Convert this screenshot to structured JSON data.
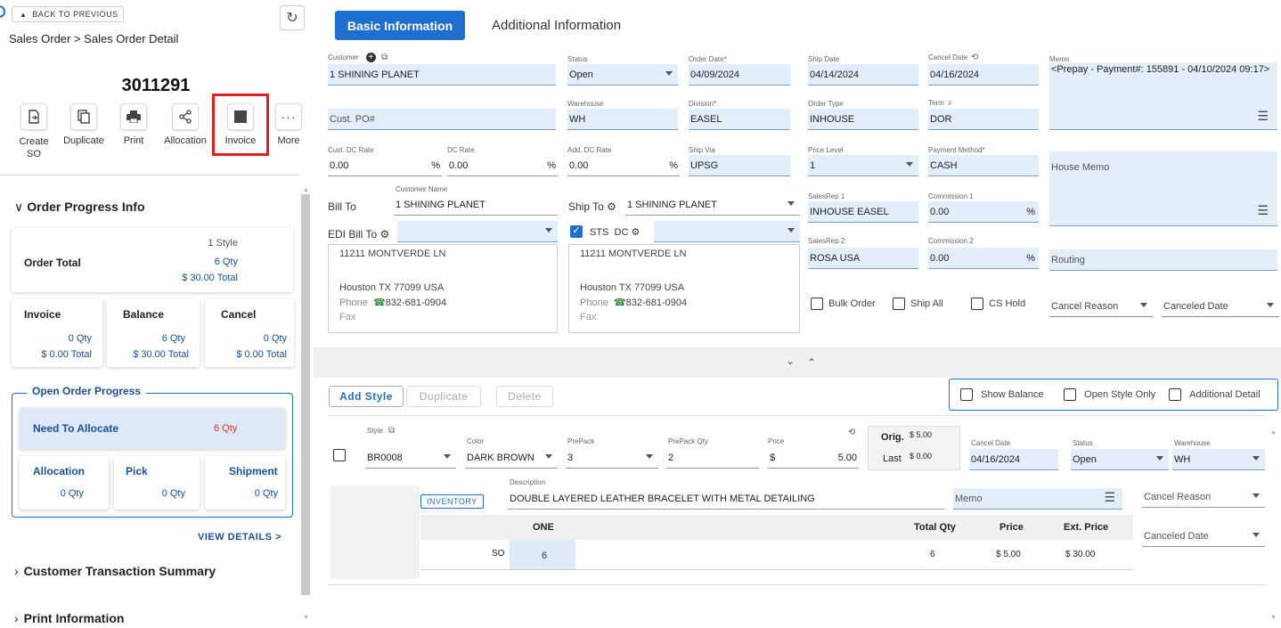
{
  "sidebar": {
    "back_label": "BACK TO PREVIOUS",
    "breadcrumb": "Sales Order > Sales Order Detail",
    "order_number": "3011291",
    "toolbar": [
      {
        "label": "Create SO",
        "icon": "create-icon"
      },
      {
        "label": "Duplicate",
        "icon": "duplicate-icon"
      },
      {
        "label": "Print",
        "icon": "print-icon"
      },
      {
        "label": "Allocation",
        "icon": "share-icon"
      },
      {
        "label": "Invoice",
        "icon": "invoice-icon"
      },
      {
        "label": "More",
        "icon": "more-icon"
      }
    ],
    "order_progress": {
      "title": "Order Progress Info",
      "order_total_label": "Order Total",
      "styles": "1 Style",
      "qty": "6 Qty",
      "total": "$ 30.00 Total",
      "invoice": {
        "label": "Invoice",
        "qty": "0 Qty",
        "total": "$ 0.00 Total"
      },
      "balance": {
        "label": "Balance",
        "qty": "6 Qty",
        "total": "$ 30.00 Total"
      },
      "cancel": {
        "label": "Cancel",
        "qty": "0 Qty",
        "total": "$ 0.00 Total"
      }
    },
    "open_order": {
      "title": "Open Order Progress",
      "need_label": "Need To Allocate",
      "need_qty": "6 Qty",
      "allocation": {
        "label": "Allocation",
        "qty": "0 Qty"
      },
      "pick": {
        "label": "Pick",
        "qty": "0 Qty"
      },
      "shipment": {
        "label": "Shipment",
        "qty": "0 Qty"
      }
    },
    "view_details": "VIEW DETAILS >",
    "customer_summary": "Customer Transaction Summary",
    "print_info": "Print Information"
  },
  "tabs": {
    "basic": "Basic Information",
    "additional": "Additional Information"
  },
  "form": {
    "customer_label": "Customer",
    "customer": "1 SHINING PLANET",
    "status_label": "Status",
    "status": "Open",
    "order_date_label": "Order Date",
    "order_date": "04/09/2024",
    "ship_date_label": "Ship Date",
    "ship_date": "04/14/2024",
    "cancel_date_label": "Cancel Date",
    "cancel_date": "04/16/2024",
    "memo_label": "Memo",
    "memo": "<Prepay - Payment#: 155891 - 04/10/2024 09:17>",
    "cust_po_placeholder": "Cust. PO#",
    "warehouse_label": "Warehouse",
    "warehouse": "WH",
    "division_label": "Division",
    "division": "EASEL",
    "order_type_label": "Order Type",
    "order_type": "INHOUSE",
    "term_label": "Term",
    "term": "DOR",
    "cust_dc_label": "Cust. DC Rate",
    "cust_dc": "0.00",
    "dc_rate_label": "DC Rate",
    "dc_rate": "0.00",
    "add_dc_label": "Add. DC Rate",
    "add_dc": "0.00",
    "ship_via_label": "Ship Via",
    "ship_via": "UPSG",
    "price_level_label": "Price Level",
    "price_level": "1",
    "payment_label": "Payment Method",
    "payment": "CASH",
    "house_memo_placeholder": "House Memo",
    "customer_name_label": "Customer Name",
    "bill_to_label": "Bill To",
    "bill_to": "1 SHINING PLANET",
    "ship_to_label": "Ship To",
    "ship_to": "1 SHINING PLANET",
    "edi_bill_to_label": "EDI Bill To",
    "sts_label": "STS",
    "dc_label": "DC",
    "salesrep1_label": "SalesRep 1",
    "salesrep1": "INHOUSE EASEL",
    "commission1_label": "Commission 1",
    "commission1": "0.00",
    "salesrep2_label": "SalesRep 2",
    "salesrep2": "ROSA USA",
    "commission2_label": "Commission 2",
    "commission2": "0.00",
    "routing_placeholder": "Routing",
    "percent": "%",
    "bill_addr": {
      "line1": "11211 MONTVERDE LN",
      "line2": "Houston TX 77099 USA",
      "phone_label": "Phone",
      "phone": "832-681-0904",
      "fax_label": "Fax"
    },
    "ship_addr": {
      "line1": "11211 MONTVERDE LN",
      "line2": "Houston TX 77099 USA",
      "phone_label": "Phone",
      "phone": "832-681-0904",
      "fax_label": "Fax"
    },
    "bulk_order": "Bulk Order",
    "ship_all": "Ship All",
    "cs_hold": "CS Hold",
    "cancel_reason": "Cancel Reason",
    "canceled_date": "Canceled Date"
  },
  "style_section": {
    "add_style": "Add Style",
    "duplicate": "Duplicate",
    "delete": "Delete",
    "show_balance": "Show Balance",
    "open_style_only": "Open Style Only",
    "additional_detail": "Additional Detail"
  },
  "line": {
    "style_label": "Style",
    "style": "BR0008",
    "color_label": "Color",
    "color": "DARK BROWN",
    "prepack_label": "PrePack",
    "prepack": "3",
    "prepack_qty_label": "PrePack Qty",
    "prepack_qty": "2",
    "price_label": "Price",
    "price_currency": "$",
    "price": "5.00",
    "orig_label": "Orig.",
    "orig": "$ 5.00",
    "last_label": "Last",
    "last": "$ 0.00",
    "cancel_date_label": "Cancel Date",
    "cancel_date": "04/16/2024",
    "status_label": "Status",
    "status": "Open",
    "warehouse_label": "Warehouse",
    "warehouse": "WH",
    "description_label": "Description",
    "description": "DOUBLE LAYERED LEATHER BRACELET WITH METAL DETAILING",
    "inventory": "INVENTORY",
    "memo_placeholder": "Memo",
    "cancel_reason": "Cancel Reason",
    "canceled_date": "Canceled Date",
    "size_header": "ONE",
    "total_qty_header": "Total Qty",
    "price_header": "Price",
    "ext_price_header": "Ext. Price",
    "row_label": "SO",
    "row_qty": "6",
    "row_total": "6",
    "row_price": "$ 5.00",
    "row_ext": "$ 30.00"
  }
}
